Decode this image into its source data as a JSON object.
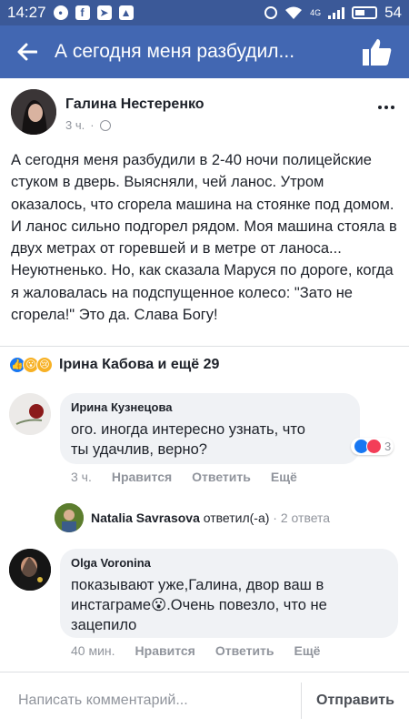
{
  "statusbar": {
    "time": "14:27",
    "signal": "4G",
    "battery": "54"
  },
  "navbar": {
    "title": "А сегодня меня разбудил..."
  },
  "post": {
    "author": "Галина Нестеренко",
    "time": "3 ч.",
    "text": "А сегодня меня разбудили в 2-40 ночи полицейские стуком в дверь. Выясняли, чей ланос. Утром оказалось, что сгорела машина на стоянке под домом. И ланос сильно подгорел рядом. Моя машина стояла в двух метрах от горевшей и в метре от ланоса... Неуютненько. Но, как сказала Маруся по дороге, когда я жаловалась на подспущенное колесо: \"Зато не сгорела!\" Это да. Слава Богу!",
    "reactions_text": "Ірина Кабова и ещё 29",
    "reaction_emojis": [
      "like",
      "wow",
      "sad"
    ]
  },
  "comments": [
    {
      "author": "Ирина Кузнецова",
      "text_lines": [
        "ого. иногда интересно узнать, что",
        "ты удачлив, верно?"
      ],
      "time": "3 ч.",
      "like": "Нравится",
      "reply": "Ответить",
      "more": "Ещё",
      "reaction_count": "3"
    },
    {
      "author": "Olga Voronina",
      "text_lines": [
        "показывают уже,Галина, двор ваш в",
        "инстаграме😮.Очень повезло, что не",
        "зацепило"
      ],
      "time": "40 мин.",
      "like": "Нравится",
      "reply": "Ответить",
      "more": "Ещё"
    }
  ],
  "reply_summary": {
    "author": "Natalia Savrasova",
    "action": " ответил(-а)",
    "dot": " · ",
    "count": "2 ответа"
  },
  "composer": {
    "placeholder": "Написать комментарий...",
    "send": "Отправить"
  },
  "colors": {
    "brand": "#4267b2",
    "statusbar": "#3b5998",
    "like_blue": "#1877f2",
    "love_red": "#f33e58",
    "wow_yellow": "#f7b125"
  }
}
